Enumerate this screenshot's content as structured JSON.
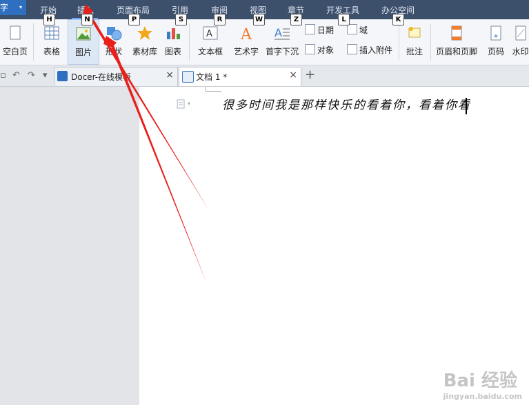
{
  "app": {
    "name_label": "字",
    "menu_caret": "▾"
  },
  "menu": {
    "tabs": [
      {
        "label": "开始",
        "key": "H"
      },
      {
        "label": "插入",
        "key": "N"
      },
      {
        "label": "页面布局",
        "key": "P"
      },
      {
        "label": "引用",
        "key": "S"
      },
      {
        "label": "审阅",
        "key": "R"
      },
      {
        "label": "视图",
        "key": "W"
      },
      {
        "label": "章节",
        "key": "Z"
      },
      {
        "label": "开发工具",
        "key": "L"
      },
      {
        "label": "办公空间",
        "key": "K"
      }
    ],
    "active_index": 1
  },
  "ribbon": {
    "blank_page": "空白页",
    "table": "表格",
    "picture": "图片",
    "shape": "形状",
    "material": "素材库",
    "chart": "图表",
    "textbox": "文本框",
    "wordart": "艺术字",
    "dropcap": "首字下沉",
    "date": "日期",
    "field": "域",
    "object": "对象",
    "attachment": "插入附件",
    "comment": "批注",
    "header_footer": "页眉和页脚",
    "page_number": "页码",
    "watermark": "水印"
  },
  "tabs": [
    {
      "label": "Docer-在线模板",
      "close": "×"
    },
    {
      "label": "文档 1 *",
      "close": "×"
    }
  ],
  "new_tab": "+",
  "document": {
    "text": "很多时间我是那样快乐的看着你，看着你看"
  },
  "watermark": {
    "main": "Bai 经验",
    "sub": "jingyan.baidu.com"
  },
  "colors": {
    "menubar": "#3c4f6b",
    "accent": "#2f6fbf",
    "arrow": "#e8201c"
  }
}
